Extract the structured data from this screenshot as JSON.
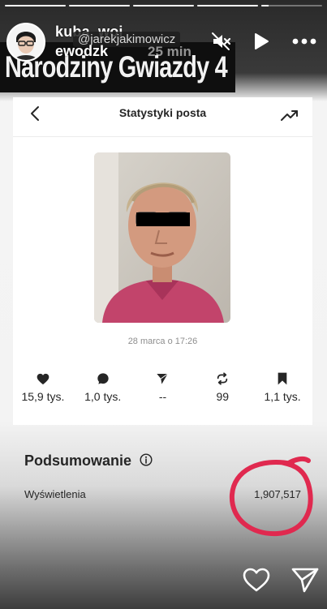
{
  "story": {
    "progress": [
      1,
      1,
      1,
      1,
      0.12
    ],
    "username": "kuba_woj",
    "username_line2": "ewodzk",
    "tagged_account": "@jarekjakimowicz",
    "time_ago": "25 min",
    "banner_title": "Narodziny Gwiazdy 4"
  },
  "post_stats": {
    "header_title": "Statystyki posta",
    "photo_date": "28 marca o 17:26",
    "metrics": [
      {
        "icon": "heart-icon",
        "value": "15,9 tys."
      },
      {
        "icon": "comment-icon",
        "value": "1,0 tys."
      },
      {
        "icon": "share-icon",
        "value": "--"
      },
      {
        "icon": "repost-icon",
        "value": "99"
      },
      {
        "icon": "bookmark-icon",
        "value": "1,1 tys."
      }
    ]
  },
  "summary": {
    "title": "Podsumowanie",
    "views_label": "Wyświetlenia",
    "views_value": "1,907,517"
  },
  "colors": {
    "annotation_circle": "#e0294f",
    "banner_bg": "#0f0f0f",
    "text_dark": "#262626",
    "text_muted": "#8e8e8e"
  }
}
